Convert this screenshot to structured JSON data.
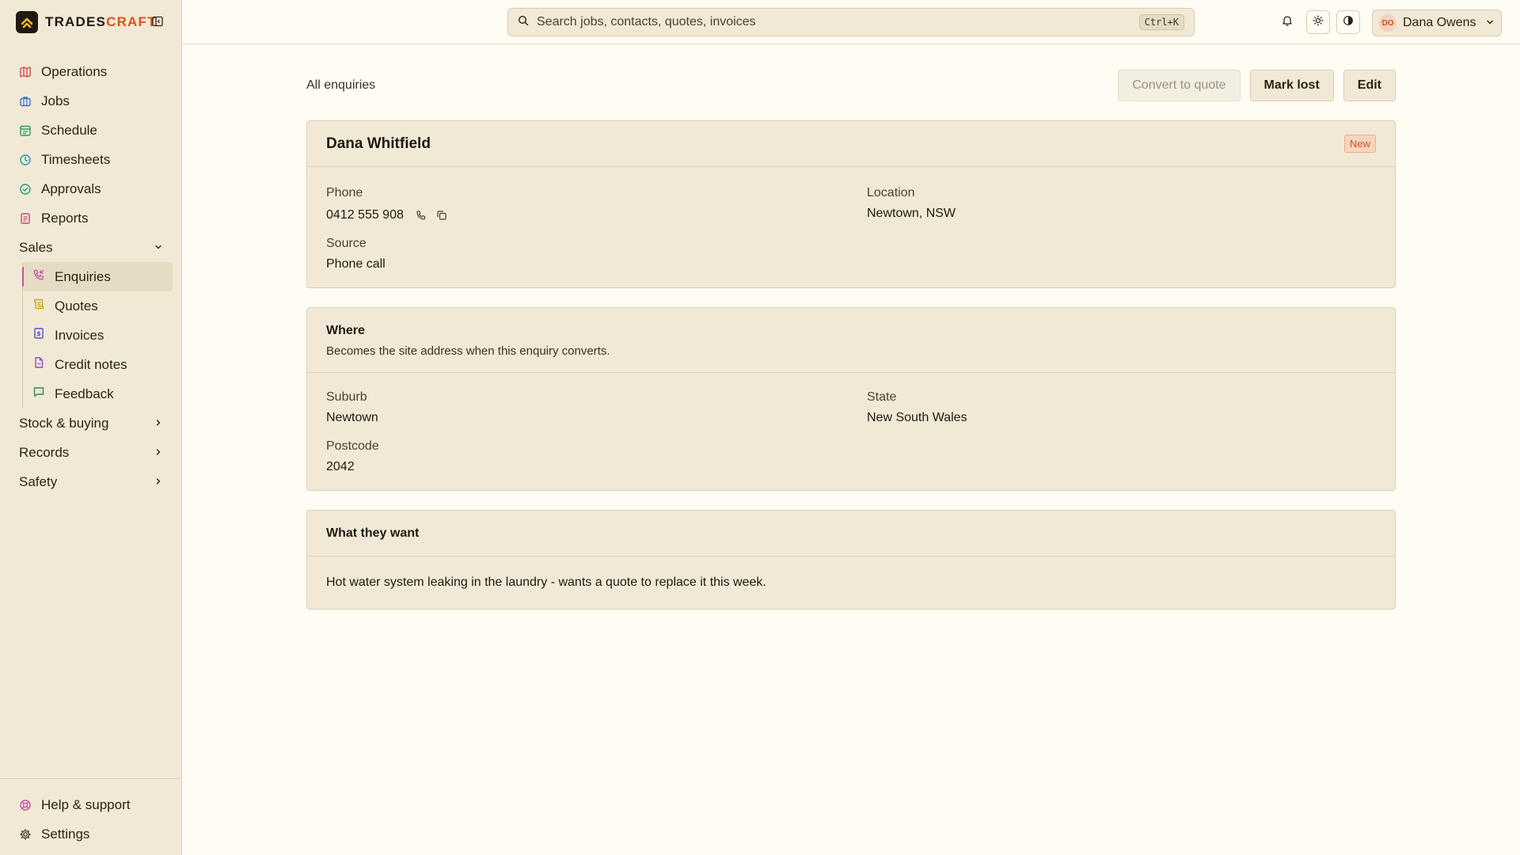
{
  "brand": {
    "name_part1": "TRADES",
    "name_part2": "CRAFT"
  },
  "sidebar": {
    "items": [
      {
        "label": "Operations",
        "icon": "map-icon",
        "color": "#d64545"
      },
      {
        "label": "Jobs",
        "icon": "briefcase-icon",
        "color": "#3b6fd6"
      },
      {
        "label": "Schedule",
        "icon": "calendar-icon",
        "color": "#2f9a57"
      },
      {
        "label": "Timesheets",
        "icon": "clock-icon",
        "color": "#1f9aa6"
      },
      {
        "label": "Approvals",
        "icon": "check-circle-icon",
        "color": "#2a9a7a"
      },
      {
        "label": "Reports",
        "icon": "report-icon",
        "color": "#c2477a"
      }
    ],
    "sales": {
      "label": "Sales",
      "items": [
        {
          "label": "Enquiries",
          "icon": "phone-incoming-icon",
          "color": "#c44ea6"
        },
        {
          "label": "Quotes",
          "icon": "scroll-icon",
          "color": "#c79b12"
        },
        {
          "label": "Invoices",
          "icon": "invoice-icon",
          "color": "#5b4fd1"
        },
        {
          "label": "Credit notes",
          "icon": "file-icon",
          "color": "#8a4fd1"
        },
        {
          "label": "Feedback",
          "icon": "message-icon",
          "color": "#2f8a4a"
        }
      ]
    },
    "groups": [
      {
        "label": "Stock & buying"
      },
      {
        "label": "Records"
      },
      {
        "label": "Safety"
      }
    ],
    "bottom": [
      {
        "label": "Help & support",
        "icon": "lifebuoy-icon",
        "color": "#c44ea6"
      },
      {
        "label": "Settings",
        "icon": "gear-icon",
        "color": "#4a4232"
      }
    ]
  },
  "search": {
    "placeholder": "Search jobs, contacts, quotes, invoices",
    "shortcut": "Ctrl+K"
  },
  "user": {
    "initials": "DO",
    "name": "Dana Owens"
  },
  "page": {
    "breadcrumb": "All enquiries",
    "actions": {
      "convert": "Convert to quote",
      "mark_lost": "Mark lost",
      "edit": "Edit"
    }
  },
  "contact": {
    "name": "Dana Whitfield",
    "status": "New",
    "phone_label": "Phone",
    "phone": "0412 555 908",
    "location_label": "Location",
    "location": "Newtown, NSW",
    "source_label": "Source",
    "source": "Phone call"
  },
  "where": {
    "title": "Where",
    "description": "Becomes the site address when this enquiry converts.",
    "suburb_label": "Suburb",
    "suburb": "Newtown",
    "state_label": "State",
    "state": "New South Wales",
    "postcode_label": "Postcode",
    "postcode": "2042"
  },
  "want": {
    "title": "What they want",
    "text": "Hot water system leaking in the laundry - wants a quote to replace it this week."
  }
}
